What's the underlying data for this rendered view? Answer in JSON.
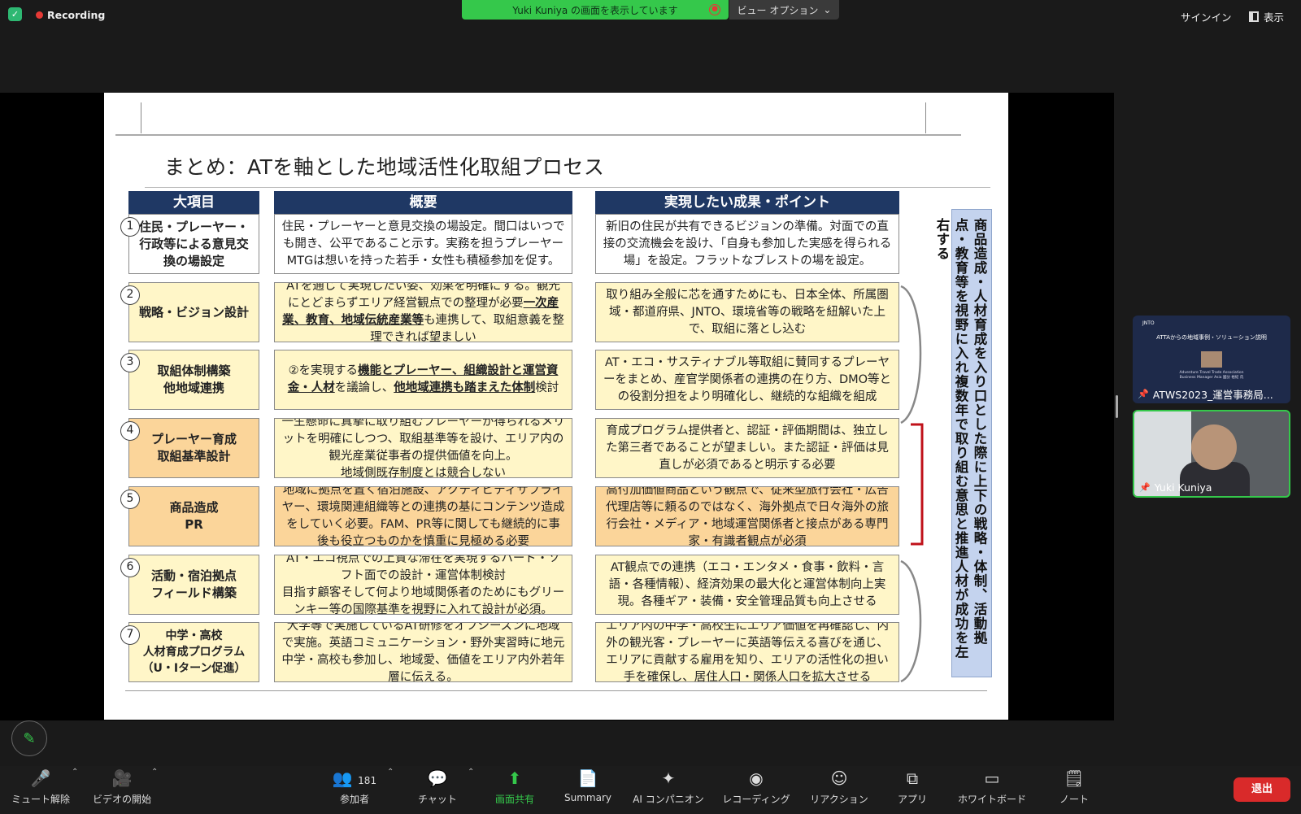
{
  "topbar": {
    "recording": "Recording",
    "share_banner": "Yuki Kuniya の画面を表示しています",
    "view_options": "ビュー オプション",
    "sign_in": "サインイン",
    "view": "表示"
  },
  "slide": {
    "title": "まとめ：ATを軸とした地域活性化取組プロセス",
    "headers": [
      "大項目",
      "概要",
      "実現したい成果・ポイント"
    ],
    "rows": [
      {
        "num": "1",
        "item": "住民・プレーヤー・行政等による意見交換の場設定",
        "summary": "住民・プレーヤーと意見交換の場設定。間口はいつでも開き、公平であること示す。実務を担うプレーヤーMTGは想いを持った若手・女性も積極参加を促す。",
        "result": "新旧の住民が共有できるビジョンの準備。対面での直接の交流機会を設け、「自身も参加した実感を得られる場」を設定。フラットなブレストの場を設定。"
      },
      {
        "num": "2",
        "item": "戦略・ビジョン設計",
        "summary_a": "ATを通じて実現したい姿、効果を明確にする。観光にとどまらずエリア経営観点での整理が必要",
        "summary_b": "一次産業、教育、地域伝統産業等",
        "summary_c": "も連携して、取組意義を整理できれば望ましい",
        "result": "取り組み全般に芯を通すためにも、日本全体、所属圏域・都道府県、JNTO、環境省等の戦略を紐解いた上で、取組に落とし込む"
      },
      {
        "num": "3",
        "item": "取組体制構築\n他地域連携",
        "summary_a": "②を実現する",
        "summary_b": "機能とプレーヤー、組織設計と運営資金・人材",
        "summary_c": "を議論し、",
        "summary_d": "他地域連携も踏まえた体制",
        "summary_e": "検討",
        "result": "AT・エコ・サスティナブル等取組に賛同するプレーヤーをまとめ、産官学関係者の連携の在り方、DMO等との役割分担をより明確化し、継続的な組織を組成"
      },
      {
        "num": "4",
        "item": "プレーヤー育成\n取組基準設計",
        "summary": "一生懸命に真摯に取り組むプレーヤーが得られるメリットを明確にしつつ、取組基準等を設け、エリア内の観光産業従事者の提供価値を向上。\n地域側既存制度とは競合しない",
        "result": "育成プログラム提供者と、認証・評価期間は、独立した第三者であることが望ましい。また認証・評価は見直しが必須であると明示する必要"
      },
      {
        "num": "5",
        "item": "商品造成\nPR",
        "summary": "地域に拠点を置く宿泊施設、アクティビティサプライヤー、環境関連組織等との連携の基にコンテンツ造成をしていく必要。FAM、PR等に関しても継続的に事後も役立つものかを慎重に見極める必要",
        "result": "高付加価値商品という観点で、従来型旅行会社・広告代理店等に頼るのではなく、海外拠点で日々海外の旅行会社・メディア・地域運営関係者と接点がある専門家・有識者観点が必須"
      },
      {
        "num": "6",
        "item": "活動・宿泊拠点\nフィールド構築",
        "summary": "AT・エコ視点での上質な滞在を実現するハード・ソフト面での設計・運営体制検討\n目指す顧客そして何より地域関係者のためにもグリーンキー等の国際基準を視野に入れて設計が必須。",
        "result": "AT観点での連携（エコ・エンタメ・食事・飲料・言語・各種情報）、経済効果の最大化と運営体制向上実現。各種ギア・装備・安全管理品質も向上させる"
      },
      {
        "num": "7",
        "item": "中学・高校\n人材育成プログラム\n（U・Iターン促進）",
        "summary": "大学等で実施しているAT研修をオフシーズンに地域で実施。英語コミュニケーション・野外実習時に地元中学・高校も参加し、地域愛、価値をエリア内外若年層に伝える。",
        "result": "エリア内の中学・高校生にエリア価値を再確認し、内外の観光客・プレーヤーに英語等伝える喜びを通じ、エリアに貢献する雇用を知り、エリアの活性化の担い手を確保し、居住人口・関係人口を拡大させる"
      }
    ],
    "side_note": "商品造成・人材育成を入り口とした際に上下の戦略・体制、活動拠点・教育等を視野に入れ複数年で取り組む意思と推進人材が成功を左右する"
  },
  "participants": {
    "thumb1_logo": "JNTO",
    "thumb1_title": "ATTAからの地域事例・ソリューション説明",
    "thumb1_sub1": "Adventure Travel Trade Association",
    "thumb1_sub2": "Business Manager Asia 國分 裕紀 氏",
    "thumb1_label": "ATWS2023_運営事務局...",
    "thumb2_label": "Yuki Kuniya"
  },
  "toolbar": {
    "mute": "ミュート解除",
    "video": "ビデオの開始",
    "participants": "参加者",
    "participants_count": "181",
    "chat": "チャット",
    "share": "画面共有",
    "summary": "Summary",
    "ai": "AI コンパニオン",
    "recording": "レコーディング",
    "reaction": "リアクション",
    "apps": "アプリ",
    "whiteboard": "ホワイトボード",
    "notes": "ノート",
    "leave": "退出"
  },
  "colors": {
    "header_navy": "#1f3864",
    "row_yellow": "#fff6c8",
    "row_orange": "#fbd59a",
    "side_blue": "#c4d3ee",
    "zoom_green": "#35c84b",
    "leave_red": "#d92a2a"
  }
}
